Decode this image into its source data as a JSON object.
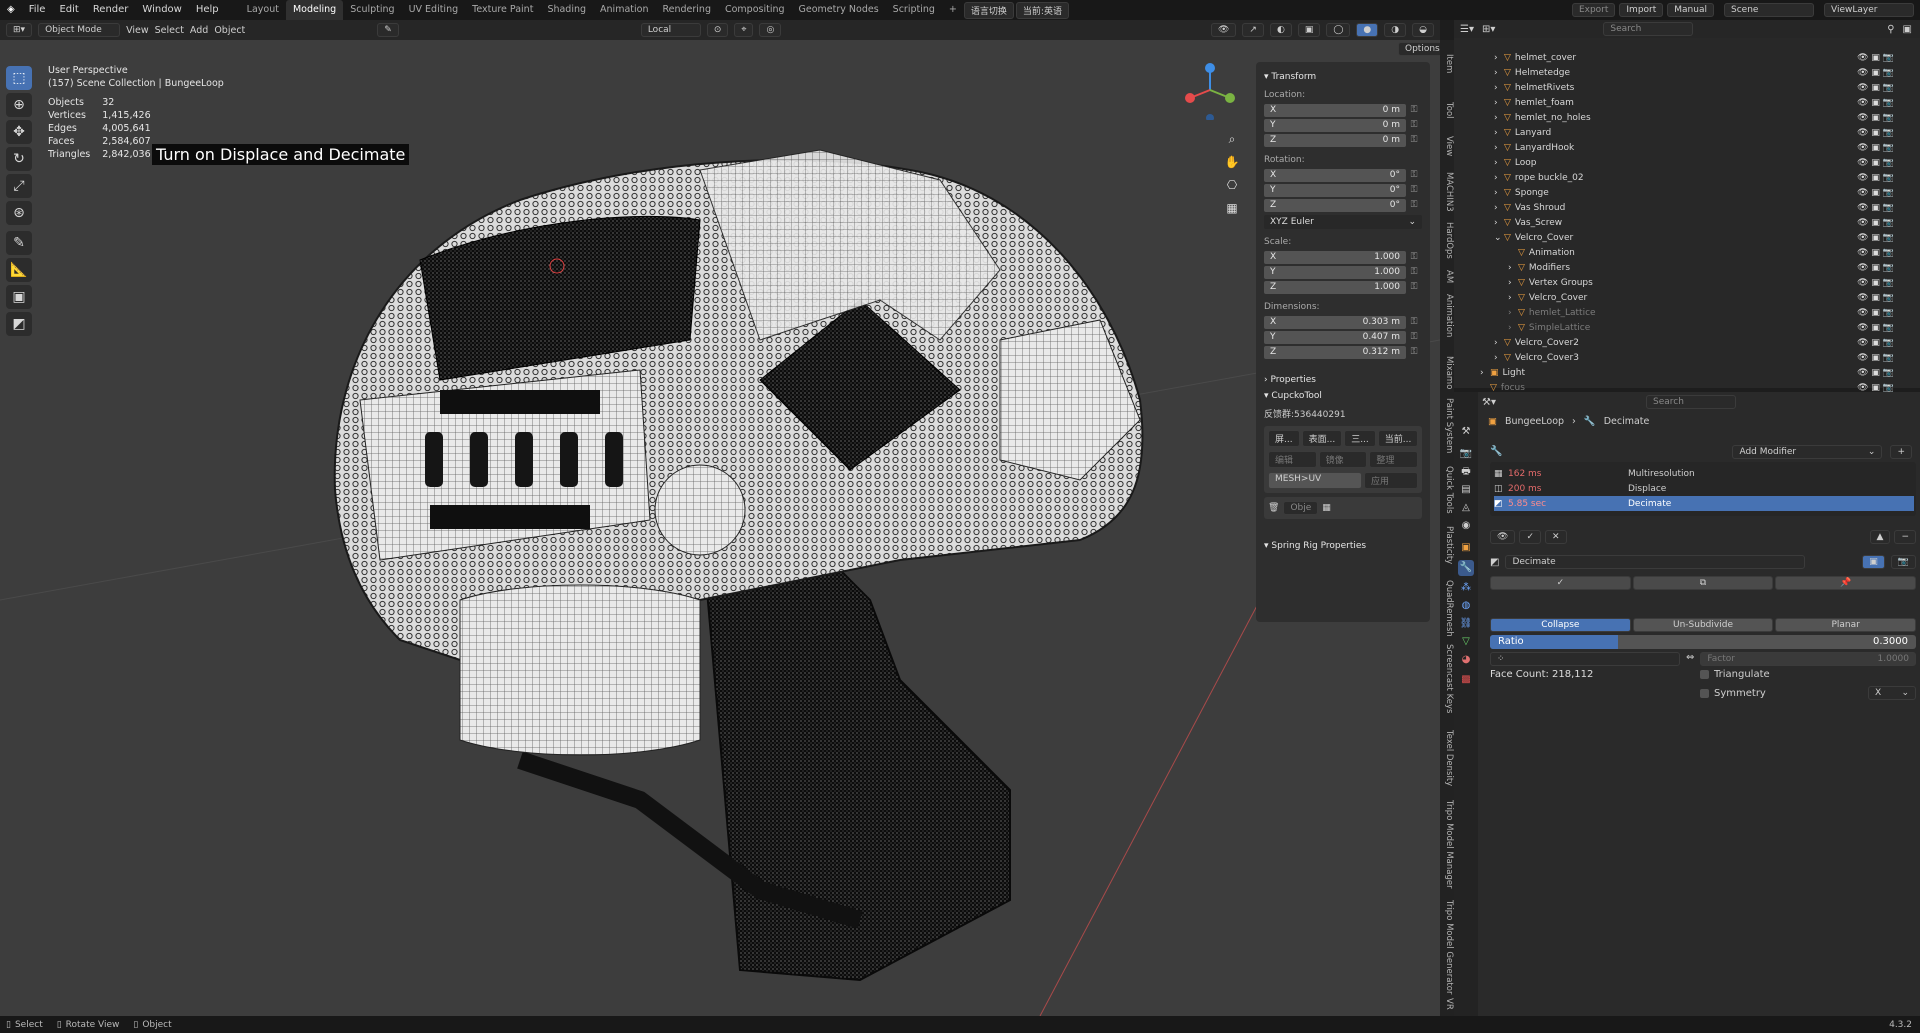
{
  "menu": [
    "File",
    "Edit",
    "Render",
    "Window",
    "Help"
  ],
  "workspaces": [
    "Layout",
    "Modeling",
    "Sculpting",
    "UV Editing",
    "Texture Paint",
    "Shading",
    "Animation",
    "Rendering",
    "Compositing",
    "Geometry Nodes",
    "Scripting"
  ],
  "active_workspace": "Modeling",
  "topbar_extra": {
    "lang": "语言切换",
    "current": "当前:英语",
    "export": "Export",
    "import": "Import",
    "manual": "Manual",
    "scene": "Scene",
    "viewlayer": "ViewLayer"
  },
  "viewport_header": {
    "mode": "Object Mode",
    "view": "View",
    "select": "Select",
    "add": "Add",
    "object": "Object",
    "orientation": "Local",
    "options": "Options"
  },
  "overlay": {
    "view_name": "User Perspective",
    "collection": "(157) Scene Collection | BungeeLoop",
    "stats": [
      {
        "label": "Objects",
        "value": "32"
      },
      {
        "label": "Vertices",
        "value": "1,415,426"
      },
      {
        "label": "Edges",
        "value": "4,005,641"
      },
      {
        "label": "Faces",
        "value": "2,584,607"
      },
      {
        "label": "Triangles",
        "value": "2,842,036"
      }
    ],
    "caption": "Turn on Displace and Decimate"
  },
  "npanel": {
    "transform": "Transform",
    "location_label": "Location:",
    "location": [
      {
        "axis": "X",
        "value": "0 m"
      },
      {
        "axis": "Y",
        "value": "0 m"
      },
      {
        "axis": "Z",
        "value": "0 m"
      }
    ],
    "rotation_label": "Rotation:",
    "rotation": [
      {
        "axis": "X",
        "value": "0°"
      },
      {
        "axis": "Y",
        "value": "0°"
      },
      {
        "axis": "Z",
        "value": "0°"
      }
    ],
    "rotation_mode": "XYZ Euler",
    "scale_label": "Scale:",
    "scale": [
      {
        "axis": "X",
        "value": "1.000"
      },
      {
        "axis": "Y",
        "value": "1.000"
      },
      {
        "axis": "Z",
        "value": "1.000"
      }
    ],
    "dimensions_label": "Dimensions:",
    "dimensions": [
      {
        "axis": "X",
        "value": "0.303 m"
      },
      {
        "axis": "Y",
        "value": "0.407 m"
      },
      {
        "axis": "Z",
        "value": "0.312 m"
      }
    ],
    "properties": "Properties",
    "cupcko": "CupckoTool",
    "feedback": "反馈群:536440291",
    "tool_btns": [
      "屏...",
      "表面...",
      "三...",
      "当前..."
    ],
    "tool_btns2": [
      "编辑",
      "镜像",
      "整理"
    ],
    "mesh_uv": "MESH>UV",
    "apply": "应用",
    "obje": "Obje",
    "spring": "Spring Rig Properties"
  },
  "vtabs": [
    "Item",
    "Tool",
    "View",
    "MACHIN3",
    "HardOps",
    "AM",
    "Animation",
    "Mixamo",
    "Paint System",
    "Quick Tools",
    "Plasticity",
    "QuadRemesh",
    "Screencast Keys",
    "Texel Density",
    "Tripo Model Manager",
    "Tripo Model Generator",
    "VR"
  ],
  "outliner": {
    "search": "Search",
    "items": [
      {
        "name": "helmet_cover",
        "dim": false
      },
      {
        "name": "Helmetedge",
        "dim": false
      },
      {
        "name": "helmetRivets",
        "dim": false
      },
      {
        "name": "hemlet_foam",
        "dim": false
      },
      {
        "name": "hemlet_no_holes",
        "dim": false
      },
      {
        "name": "Lanyard",
        "dim": false
      },
      {
        "name": "LanyardHook",
        "dim": false
      },
      {
        "name": "Loop",
        "dim": false
      },
      {
        "name": "rope buckle_02",
        "dim": false
      },
      {
        "name": "Sponge",
        "dim": false
      },
      {
        "name": "Vas Shroud",
        "dim": false
      },
      {
        "name": "Vas_Screw",
        "dim": false
      },
      {
        "name": "Velcro_Cover",
        "dim": false
      },
      {
        "name": "Animation",
        "dim": false
      },
      {
        "name": "Modifiers",
        "dim": false
      },
      {
        "name": "Vertex Groups",
        "dim": false
      },
      {
        "name": "Velcro_Cover",
        "dim": false
      },
      {
        "name": "hemlet_Lattice",
        "dim": true
      },
      {
        "name": "SimpleLattice",
        "dim": true
      },
      {
        "name": "Velcro_Cover2",
        "dim": false
      },
      {
        "name": "Velcro_Cover3",
        "dim": false
      },
      {
        "name": "Light",
        "dim": false
      },
      {
        "name": "focus",
        "dim": true
      }
    ]
  },
  "properties": {
    "search": "Search",
    "breadcrumb_obj": "BungeeLoop",
    "breadcrumb_mod": "Decimate",
    "add_modifier": "Add Modifier",
    "stack": [
      {
        "time": "162 ms",
        "name": "Multiresolution"
      },
      {
        "time": "200 ms",
        "name": "Displace"
      },
      {
        "time": "5.85 sec",
        "name": "Decimate"
      }
    ],
    "modifier_name": "Decimate",
    "modes": [
      "Collapse",
      "Un-Subdivide",
      "Planar"
    ],
    "ratio_label": "Ratio",
    "ratio_value": "0.3000",
    "ratio": 0.3,
    "factor_label": "Factor",
    "factor_value": "1.0000",
    "face_count": "Face Count: 218,112",
    "triangulate": "Triangulate",
    "symmetry": "Symmetry",
    "symmetry_axis": "X"
  },
  "status": {
    "select": "Select",
    "rotate": "Rotate View",
    "object": "Object",
    "version": "4.3.2"
  }
}
